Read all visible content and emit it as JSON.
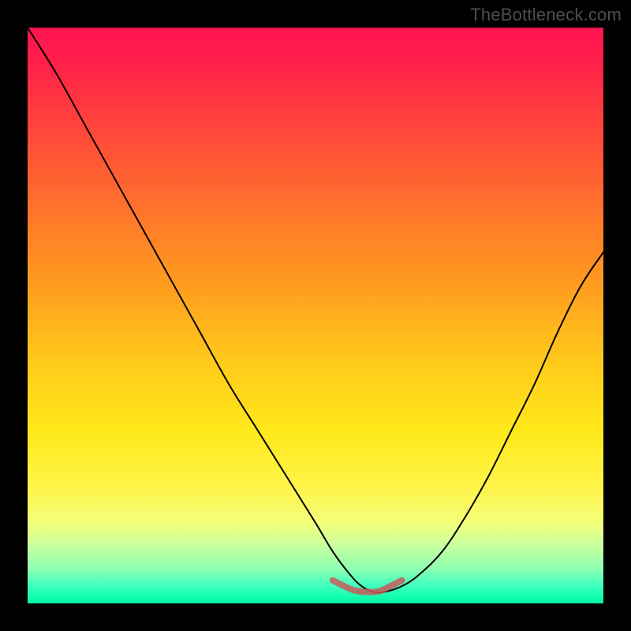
{
  "watermark": "TheBottleneck.com",
  "colors": {
    "frame_background": "#000000",
    "watermark_text": "#4e4e4e",
    "curve_stroke": "#000000",
    "highlight_stroke": "#c95a5a",
    "gradient_top": "#ff1450",
    "gradient_bottom": "#08f59c"
  },
  "chart_data": {
    "type": "line",
    "title": "",
    "xlabel": "",
    "ylabel": "",
    "xlim": [
      0,
      100
    ],
    "ylim": [
      0,
      100
    ],
    "grid": false,
    "legend": false,
    "annotations": [],
    "series": [
      {
        "name": "bottleneck-curve",
        "x": [
          0,
          5,
          10,
          15,
          20,
          25,
          30,
          35,
          40,
          45,
          50,
          53,
          56,
          58,
          60,
          62,
          65,
          68,
          72,
          76,
          80,
          84,
          88,
          92,
          96,
          100
        ],
        "values": [
          100,
          92,
          83,
          74,
          65,
          56,
          47,
          38,
          30,
          22,
          14,
          9,
          5,
          3,
          2,
          2,
          3,
          5,
          9,
          15,
          22,
          30,
          38,
          47,
          55,
          61
        ]
      },
      {
        "name": "optimal-highlight",
        "x": [
          53,
          55,
          57,
          59,
          61,
          63,
          65
        ],
        "values": [
          4,
          3,
          2.2,
          2,
          2.1,
          3,
          4
        ]
      }
    ],
    "background_gradient_meaning": "vertical gradient from high-bottleneck (red, top) to no-bottleneck (green, bottom)"
  }
}
